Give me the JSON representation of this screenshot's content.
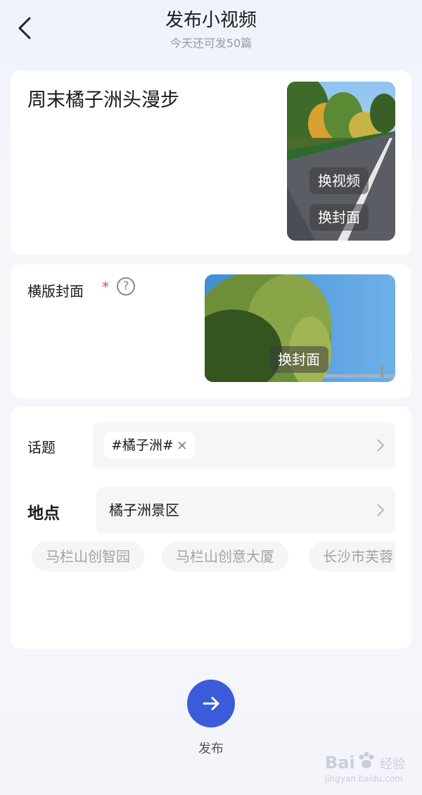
{
  "header": {
    "title": "发布小视频",
    "subtitle": "今天还可发50篇"
  },
  "video": {
    "title": "周末橘子洲头漫步",
    "change_video_label": "换视频",
    "change_cover_label": "换封面"
  },
  "landscape_cover": {
    "label": "横版封面",
    "required_mark": "*",
    "help_glyph": "?",
    "change_cover_label": "换封面"
  },
  "topic": {
    "label": "话题",
    "chip": "#橘子洲#",
    "chip_close": "×"
  },
  "location": {
    "label": "地点",
    "value": "橘子洲景区",
    "suggestions": [
      "马栏山创智园",
      "马栏山创意大厦",
      "长沙市芙蓉"
    ]
  },
  "publish": {
    "label": "发布"
  },
  "watermark": {
    "brand": "Bai",
    "brand_suffix": "经验",
    "url": "jingyan.baidu.com"
  },
  "colors": {
    "accent": "#3b5bdb",
    "required": "#e84545",
    "background": "#f3f5fb"
  }
}
